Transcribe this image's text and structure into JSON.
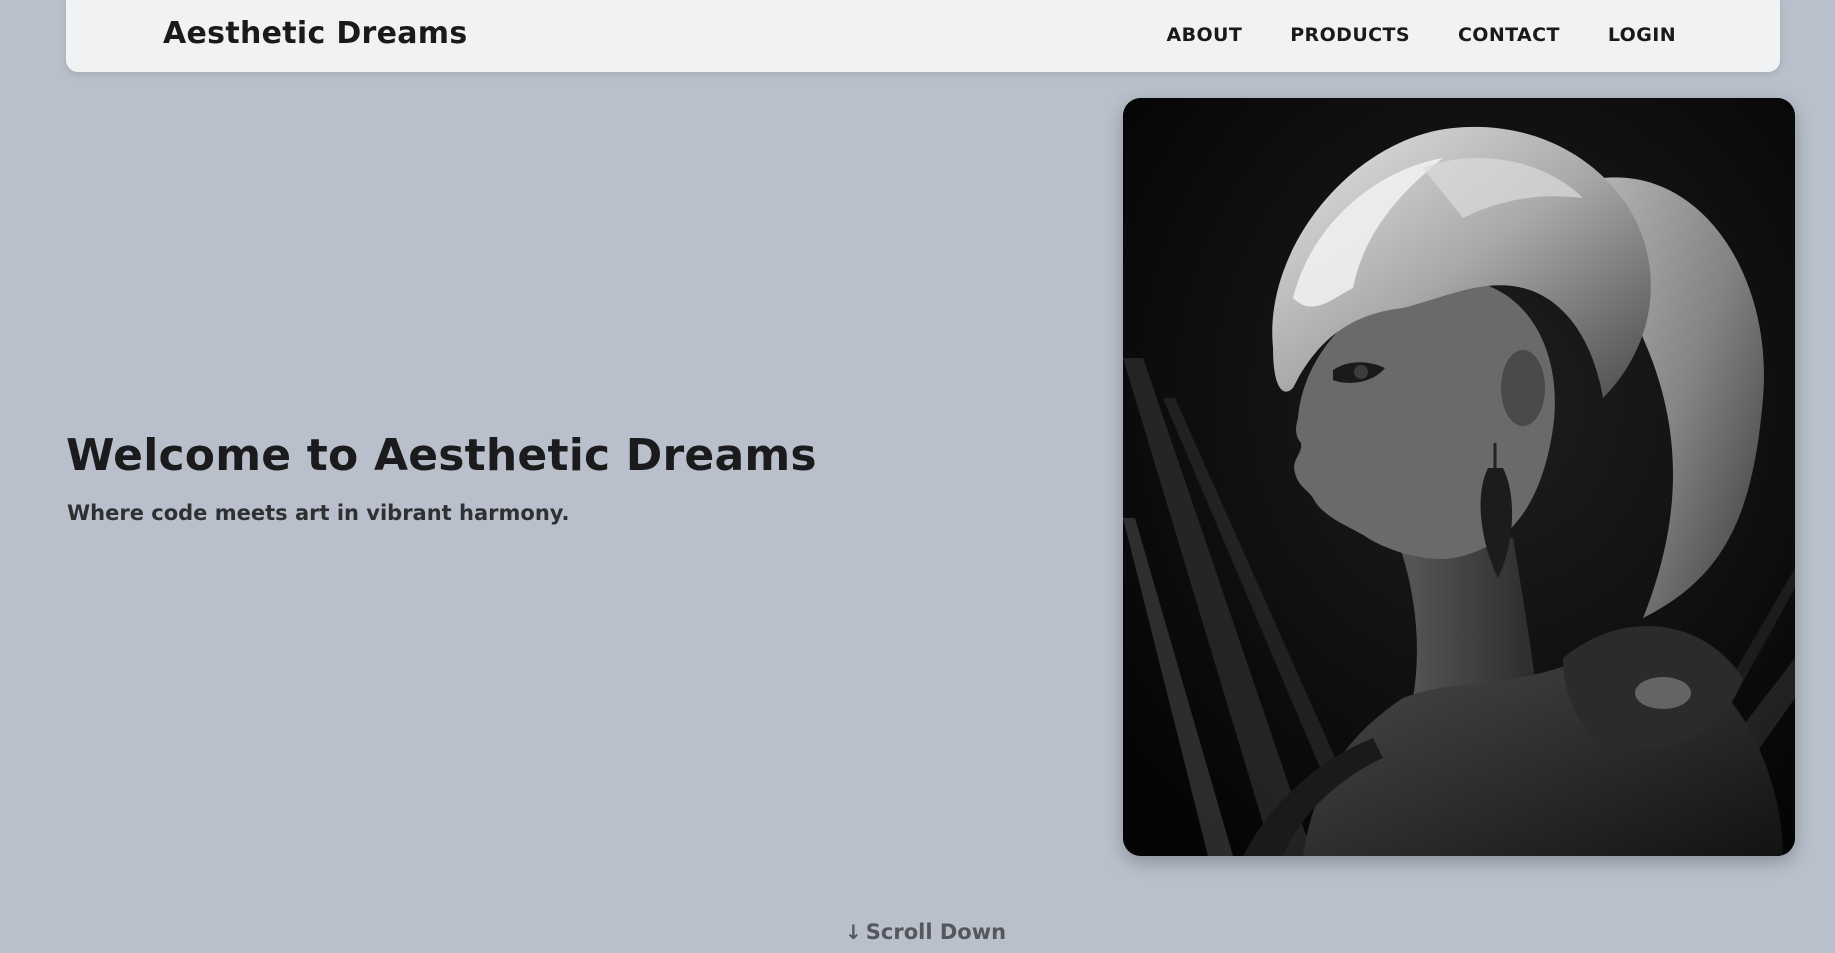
{
  "header": {
    "brand": "Aesthetic Dreams",
    "nav": [
      {
        "label": "ABOUT"
      },
      {
        "label": "PRODUCTS"
      },
      {
        "label": "CONTACT"
      },
      {
        "label": "LOGIN"
      }
    ]
  },
  "hero": {
    "title": "Welcome to Aesthetic Dreams",
    "subtitle": "Where code meets art in vibrant harmony.",
    "image_icon": "illustration-anime-warrior-portrait"
  },
  "scroll": {
    "arrow_icon": "arrow-down-icon",
    "label": "Scroll Down"
  },
  "colors": {
    "background": "#b9c0cb",
    "navbar": "#f1f2f4",
    "text": "#1b1b1d",
    "muted_text": "#55575c"
  }
}
